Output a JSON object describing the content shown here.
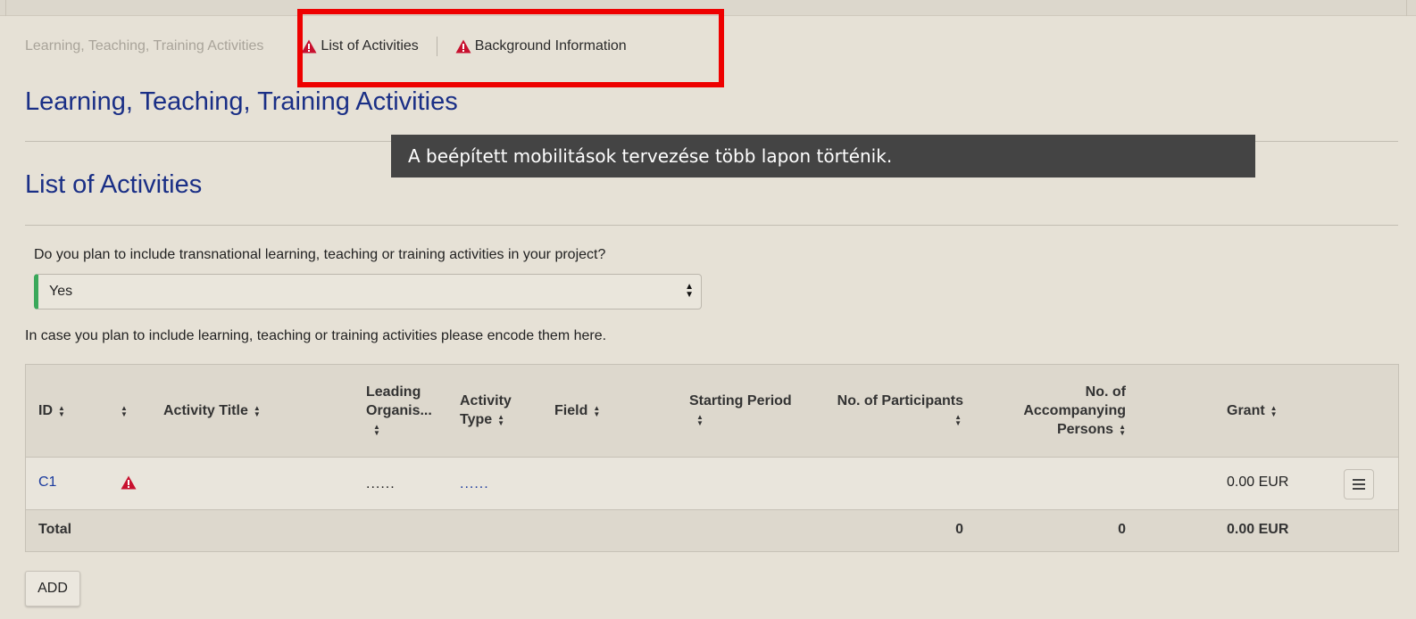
{
  "breadcrumb": {
    "muted": "Learning, Teaching, Training Activities",
    "tab1": "List of Activities",
    "tab2": "Background Information"
  },
  "page_title": "Learning, Teaching, Training Activities",
  "section_title": "List of Activities",
  "tooltip": "A beépített mobilitások tervezése több lapon történik.",
  "question": "Do you plan to include transnational learning, teaching or training activities in your project?",
  "select_value": "Yes",
  "note": "In case you plan to include learning, teaching or training activities please encode them here.",
  "table": {
    "headers": {
      "id": "ID",
      "title": "Activity Title",
      "leading_l1": "Leading",
      "leading_l2": "Organis...",
      "type_l1": "Activity",
      "type_l2": "Type",
      "field": "Field",
      "starting": "Starting Period",
      "participants": "No. of Participants",
      "accompany_l1": "No. of",
      "accompany_l2": "Accompanying",
      "accompany_l3": "Persons",
      "grant": "Grant"
    },
    "row": {
      "id": "C1",
      "leading": "......",
      "type": "......",
      "grant": "0.00 EUR"
    },
    "total": {
      "label": "Total",
      "participants": "0",
      "accompany": "0",
      "grant": "0.00 EUR"
    }
  },
  "add_button": "ADD",
  "colors": {
    "accent_title": "#1a2f86",
    "warning": "#c8102e",
    "highlight": "#ee0000",
    "select_indicator": "#3aa85a"
  }
}
